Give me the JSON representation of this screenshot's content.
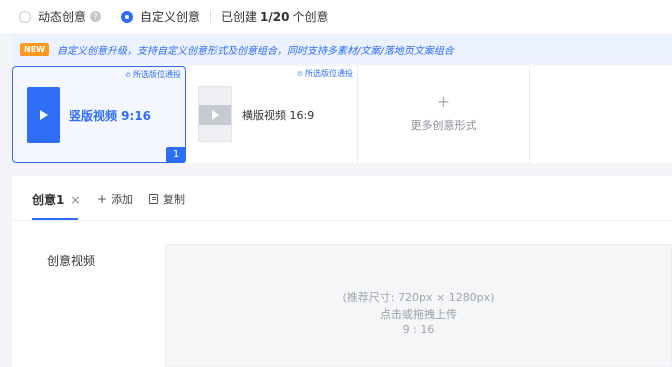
{
  "mode": {
    "dynamic_label": "动态创意",
    "custom_label": "自定义创意",
    "created_prefix": "已创建",
    "created_count": "1/20",
    "created_suffix": "个创意",
    "help_glyph": "?"
  },
  "notice": {
    "badge": "NEW",
    "text": "自定义创意升级，支持自定义创意形式及创意组合，同时支持多素材/文案/落地页文案组合"
  },
  "formats": [
    {
      "hint": "所选版位通投",
      "title": "竖版视频 9:16",
      "selected": true,
      "count": "1"
    },
    {
      "hint": "所选版位通投",
      "title": "横版视频 16:9",
      "selected": false
    },
    {
      "plus": "+",
      "title": "更多创意形式"
    }
  ],
  "creative": {
    "tab_label": "创意1",
    "close_glyph": "×",
    "add_label": "添加",
    "add_glyph": "+",
    "copy_label": "复制",
    "field_label": "创意视频",
    "upload": {
      "size_hint": "(推荐尺寸: 720px × 1280px)",
      "action": "点击或拖拽上传",
      "ratio": "9 : 16"
    }
  },
  "colors": {
    "accent": "#2e6df6",
    "badge": "#ff9a1f",
    "notice_bg": "#ebf1ff",
    "page_bg": "#f3f5f8"
  }
}
